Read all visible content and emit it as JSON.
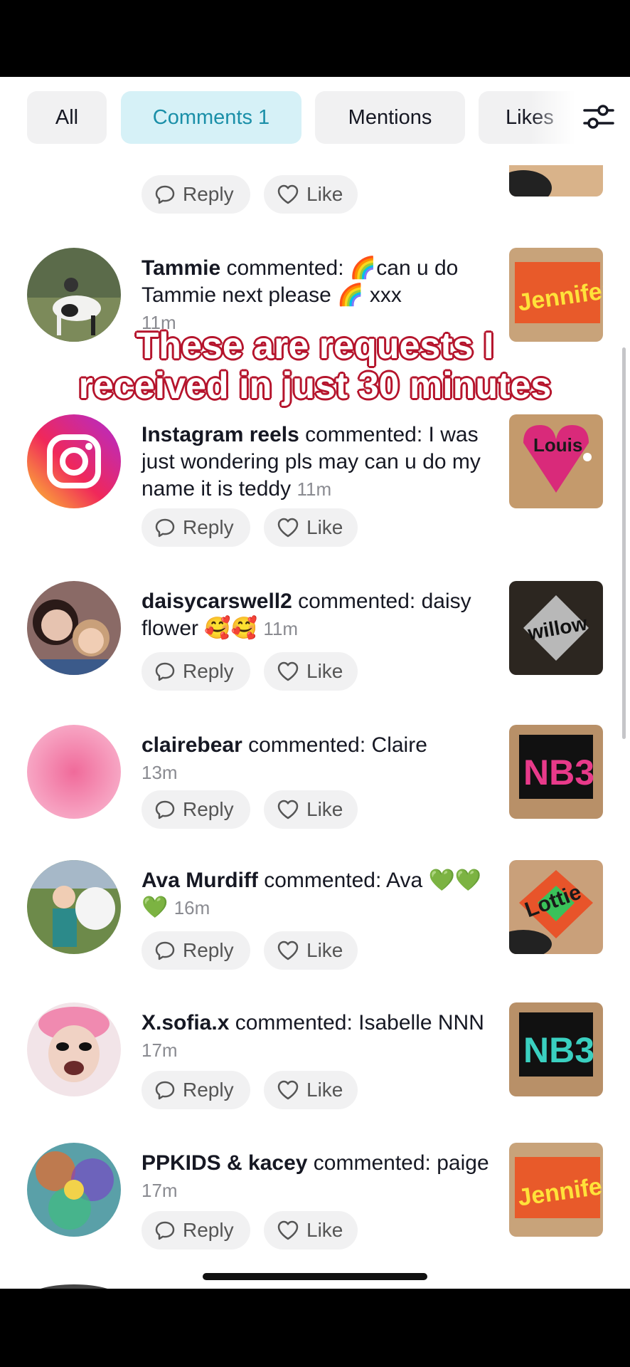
{
  "tabs": {
    "all": "All",
    "comments": "Comments 1",
    "mentions": "Mentions",
    "likes": "Likes"
  },
  "actions": {
    "reply": "Reply",
    "like": "Like"
  },
  "overlay": {
    "line1": "These are requests I",
    "line2": "received in just 30 minutes"
  },
  "comments": [
    {
      "user": "Tammie",
      "verb": "commented:",
      "message": "🌈can u do Tammie next please 🌈 xxx",
      "time": "11m"
    },
    {
      "user": "Instagram reels",
      "verb": "commented:",
      "message": "I was just wondering pls may can u do my name it is teddy",
      "time": "11m"
    },
    {
      "user": "daisycarswell2",
      "verb": "commented:",
      "message": "daisy flower 🥰🥰",
      "time": "11m"
    },
    {
      "user": "clairebear",
      "verb": "commented:",
      "message": "Claire",
      "time": "13m"
    },
    {
      "user": "Ava Murdiff",
      "verb": "commented:",
      "message": "Ava 💚💚💚",
      "time": "16m"
    },
    {
      "user": "X.sofia.x",
      "verb": "commented:",
      "message": "Isabelle NNN",
      "time": "17m"
    },
    {
      "user": "PPKIDS & kacey",
      "verb": "commented:",
      "message": "paige",
      "time": "17m"
    }
  ],
  "thumb_texts": [
    "Jennifer",
    "Louis",
    "willow",
    "NB3",
    "Lottie",
    "NB3",
    "Jennifer"
  ],
  "colors": {
    "accent_tab_bg": "#d6f1f7",
    "accent_tab_text": "#1a8fa8",
    "overlay_outline": "#b5142c"
  }
}
